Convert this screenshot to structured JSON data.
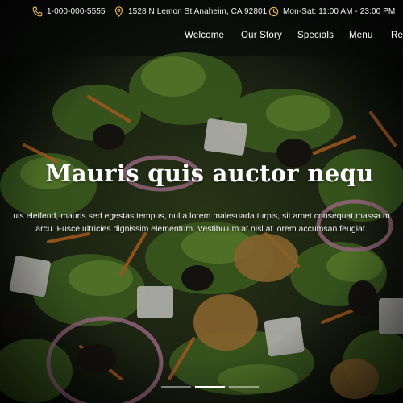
{
  "topbar": {
    "phone": "1-000-000-5555",
    "address": "1528 N Lemon St Anaheim, CA 92801",
    "hours": "Mon-Sat: 11:00 AM - 23:00 PM",
    "accent_color": "#e8b94a"
  },
  "nav": {
    "items": [
      {
        "label": "Welcome"
      },
      {
        "label": "Our Story"
      },
      {
        "label": "Specials"
      },
      {
        "label": "Menu"
      },
      {
        "label": "Re"
      }
    ]
  },
  "hero": {
    "title": "Mauris quis auctor nequ",
    "subtitle_line1": "uis eleifend, mauris sed egestas tempus, nul a lorem malesuada turpis, sit amet consequat massa m",
    "subtitle_line2": "arcu. Fusce ultricies dignissim elementum. Vestibulum at nisl at lorem accumsan feugiat."
  },
  "slider": {
    "slide_count": 3,
    "active_index": 1
  }
}
